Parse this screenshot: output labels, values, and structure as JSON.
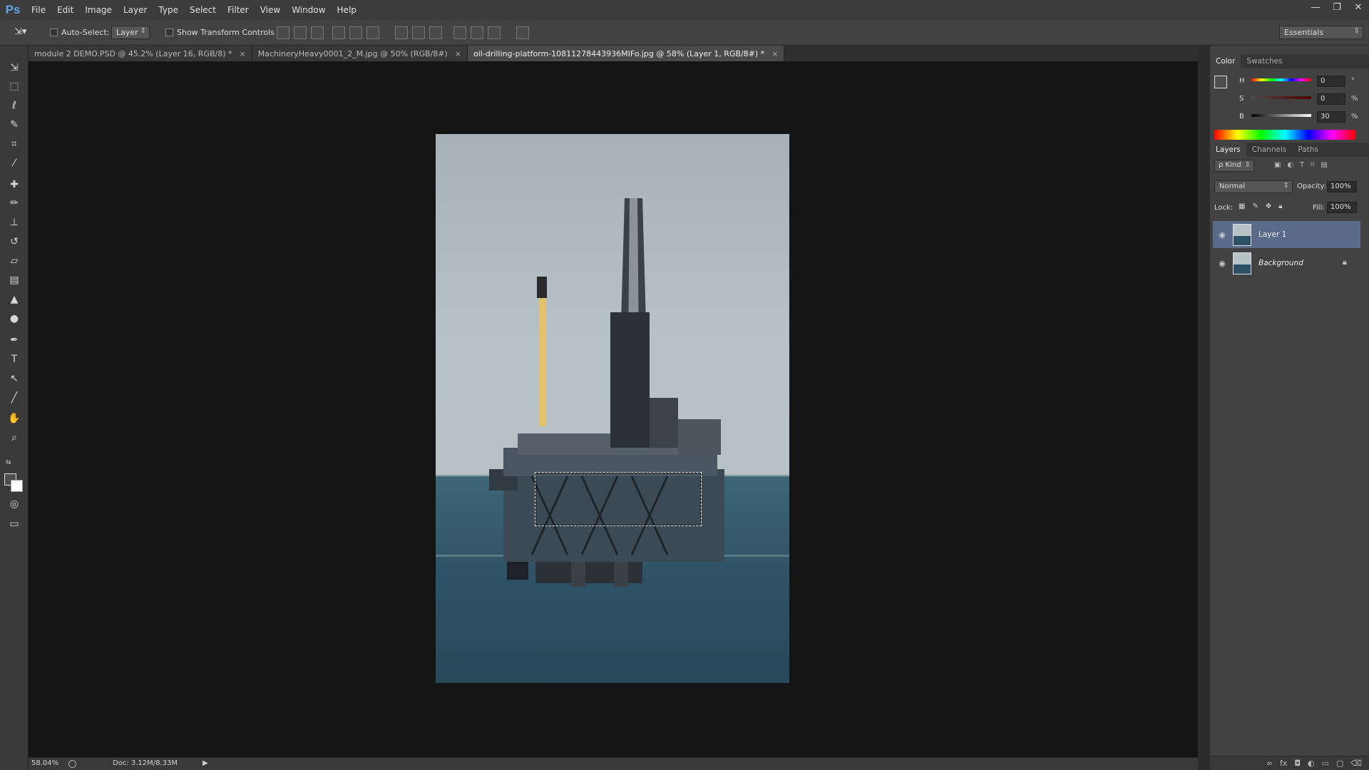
{
  "app": {
    "logo": "Ps"
  },
  "menu": [
    "File",
    "Edit",
    "Image",
    "Layer",
    "Type",
    "Select",
    "Filter",
    "View",
    "Window",
    "Help"
  ],
  "window_controls": {
    "minimize": "—",
    "restore": "❐",
    "close": "✕"
  },
  "options": {
    "auto_select_label": "Auto-Select:",
    "auto_select_value": "Layer",
    "show_transform_label": "Show Transform Controls",
    "workspace": "Essentials"
  },
  "tabs": [
    {
      "label": "module 2 DEMO.PSD @ 45.2% (Layer 16, RGB/8) *",
      "close": "×"
    },
    {
      "label": "MachineryHeavy0001_2_M.jpg @ 50% (RGB/8#)",
      "close": "×"
    },
    {
      "label": "oil-drilling-platform-10811278443936MIFo.jpg @ 58% (Layer 1, RGB/8#) *",
      "close": "×"
    }
  ],
  "tools": {
    "move": "⇲",
    "marquee": "⬚",
    "lasso": "ℓ",
    "quick_select": "✎",
    "crop": "⌗",
    "eyedropper": "⁄",
    "healing": "✚",
    "brush": "✏",
    "stamp": "⊥",
    "history_brush": "↺",
    "eraser": "▱",
    "gradient": "▤",
    "blur": "▲",
    "dodge": "●",
    "pen": "✒",
    "type": "T",
    "path_select": "↖",
    "line": "╱",
    "hand": "✋",
    "zoom": "⌕",
    "quick_mask": "◎",
    "screen_mode": "▭"
  },
  "status": {
    "zoom": "58.04%",
    "doc": "Doc: 3.12M/8.33M",
    "arrow": "▶"
  },
  "color_panel": {
    "tabs": [
      "Color",
      "Swatches"
    ],
    "h_label": "H",
    "h_value": "0",
    "h_unit": "°",
    "s_label": "S",
    "s_value": "0",
    "s_unit": "%",
    "b_label": "B",
    "b_value": "30",
    "b_unit": "%"
  },
  "layers_panel": {
    "tabs": [
      "Layers",
      "Channels",
      "Paths"
    ],
    "kind_label": "ρ Kind",
    "blend_mode": "Normal",
    "opacity_label": "Opacity:",
    "opacity_value": "100%",
    "lock_label": "Lock:",
    "fill_label": "Fill:",
    "fill_value": "100%",
    "layers": [
      {
        "name": "Layer 1",
        "active": true
      },
      {
        "name": "Background",
        "active": false,
        "locked": true
      }
    ]
  },
  "colors": {
    "accent_layer": "#5a6a8a",
    "canvas_bg": "#141414",
    "logo": "#5fa8e8"
  }
}
